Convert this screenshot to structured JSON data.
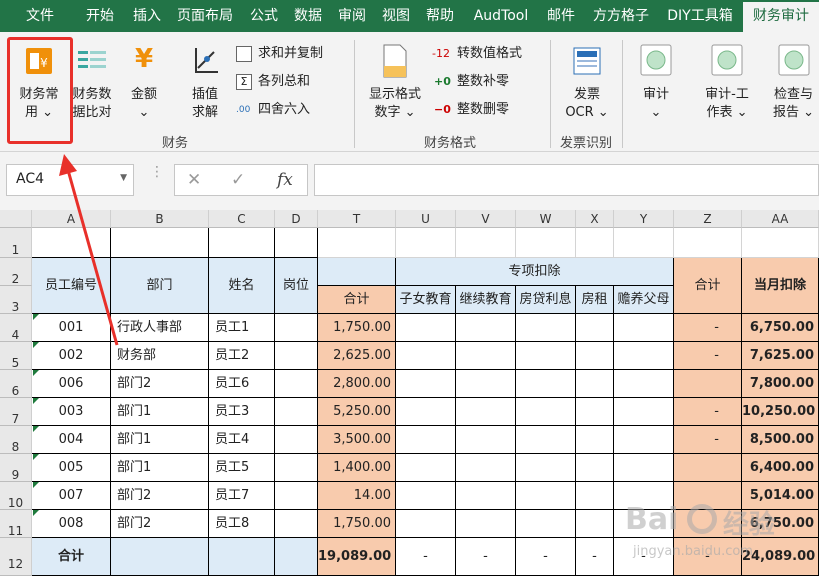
{
  "menu_tabs": [
    "文件",
    "开始",
    "插入",
    "页面布局",
    "公式",
    "数据",
    "审阅",
    "视图",
    "帮助",
    "AudTool",
    "邮件",
    "方方格子",
    "DIY工具箱",
    "财务审计"
  ],
  "ribbon": {
    "finance_common": [
      "财务常",
      "用 ⌄"
    ],
    "finance_compare": [
      "财务数",
      "据比对"
    ],
    "amount": [
      "金额",
      "⌄"
    ],
    "interp": [
      "插值",
      "求解"
    ],
    "sum_copy": "求和并复制",
    "col_sum": "各列总和",
    "round": "四舍六入",
    "group_finance": "财务",
    "display_format": [
      "显示格式",
      "数字 ⌄"
    ],
    "to_number": "转数值格式",
    "int_fill": "整数补零",
    "int_del": "整数删零",
    "group_format": "财务格式",
    "invoice": [
      "发票",
      "OCR ⌄"
    ],
    "group_invoice": "发票识别",
    "audit": [
      "审计",
      "⌄"
    ],
    "audit_work": [
      "审计-工",
      "作表 ⌄"
    ],
    "check_report": [
      "检查与",
      "报告 ⌄"
    ]
  },
  "formula_bar": {
    "name_box": "AC4",
    "fx": "fx",
    "cancel": "✕",
    "enter": "✓"
  },
  "columns": [
    "A",
    "B",
    "C",
    "D",
    "T",
    "U",
    "V",
    "W",
    "X",
    "Y",
    "Z",
    "AA"
  ],
  "row_numbers": [
    "1",
    "2",
    "3",
    "4",
    "5",
    "6",
    "7",
    "8",
    "9",
    "10",
    "11",
    "12"
  ],
  "headers": {
    "emp_id": "员工编号",
    "dept": "部门",
    "name": "姓名",
    "post": "岗位",
    "total": "合计",
    "special": "专项扣除",
    "sub": [
      "子女教育",
      "继续教育",
      "房贷利息",
      "房租",
      "赡养父母"
    ],
    "total2": "合计",
    "monthly": "当月扣除"
  },
  "rows": [
    {
      "id": "001",
      "dept": "行政人事部",
      "name": "员工1",
      "t": "1,750.00",
      "z": "-",
      "aa": "6,750.00"
    },
    {
      "id": "002",
      "dept": "财务部",
      "name": "员工2",
      "t": "2,625.00",
      "z": "-",
      "aa": "7,625.00"
    },
    {
      "id": "006",
      "dept": "部门2",
      "name": "员工6",
      "t": "2,800.00",
      "z": "",
      "aa": "7,800.00"
    },
    {
      "id": "003",
      "dept": "部门1",
      "name": "员工3",
      "t": "5,250.00",
      "z": "-",
      "aa": "10,250.00"
    },
    {
      "id": "004",
      "dept": "部门1",
      "name": "员工4",
      "t": "3,500.00",
      "z": "-",
      "aa": "8,500.00"
    },
    {
      "id": "005",
      "dept": "部门1",
      "name": "员工5",
      "t": "1,400.00",
      "z": "",
      "aa": "6,400.00"
    },
    {
      "id": "007",
      "dept": "部门2",
      "name": "员工7",
      "t": "14.00",
      "z": "",
      "aa": "5,014.00"
    },
    {
      "id": "008",
      "dept": "部门2",
      "name": "员工8",
      "t": "1,750.00",
      "z": "",
      "aa": "6,750.00"
    }
  ],
  "total_row": {
    "label": "合计",
    "t": "19,089.00",
    "dashes": [
      "-",
      "-",
      "-",
      "-",
      "-",
      "-"
    ],
    "aa": "24,089.00"
  },
  "watermark": [
    "Bai",
    "经验"
  ],
  "watermark_url": "jingyan.baidu.com",
  "colors": {
    "accent": "#227447",
    "highlight": "#e8302a",
    "blue": "#ddebf7",
    "pink": "#f8cbad"
  }
}
